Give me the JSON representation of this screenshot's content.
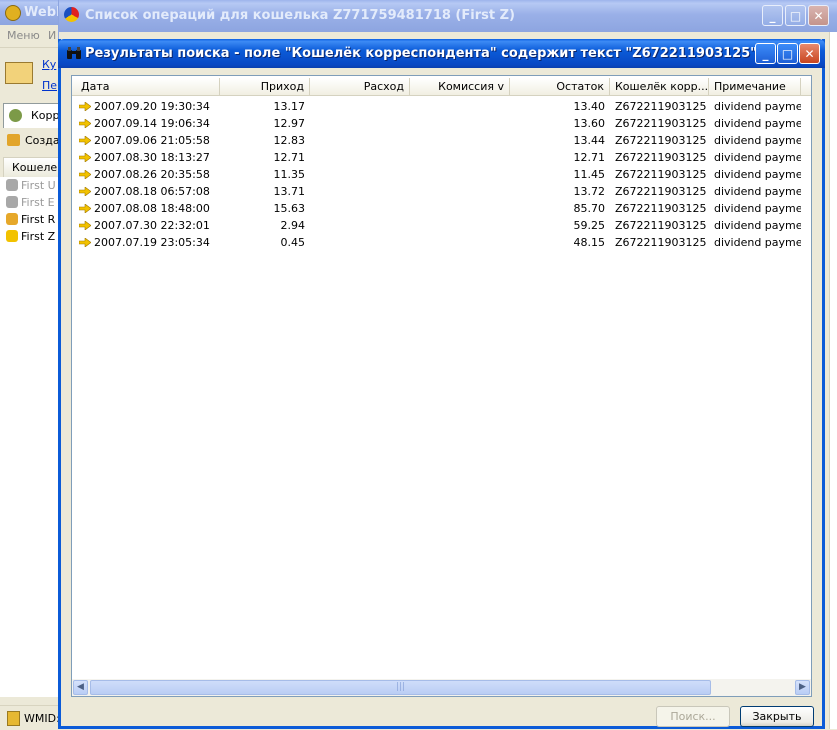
{
  "bg_app": {
    "title": "WebM",
    "menu": [
      "Меню",
      "И"
    ],
    "links": [
      "Ку",
      "Пер"
    ],
    "tab_label": "Корр",
    "create_label": "Созда",
    "wallets_header": "Кошелек",
    "wallets": [
      {
        "label": "First U",
        "dim": true
      },
      {
        "label": "First E",
        "dim": true
      },
      {
        "label": "First R",
        "dim": false
      },
      {
        "label": "First Z",
        "dim": false
      }
    ],
    "status": "WMID:"
  },
  "ops_window": {
    "title": "Список операций для кошелька Z771759481718 (First Z)"
  },
  "search_window": {
    "title": "Результаты поиска - поле \"Кошелёк корреспондента\" содержит текст \"Z672211903125\"",
    "columns": [
      "Дата",
      "Приход",
      "Расход",
      "Комиссия  v",
      "Остаток",
      "Кошелёк корр...",
      "Примечание"
    ],
    "rows": [
      {
        "date": "2007.09.20 19:30:34",
        "income": "13.17",
        "expense": "",
        "fee": "",
        "balance": "13.40",
        "wallet": "Z672211903125",
        "note": "dividend payment"
      },
      {
        "date": "2007.09.14 19:06:34",
        "income": "12.97",
        "expense": "",
        "fee": "",
        "balance": "13.60",
        "wallet": "Z672211903125",
        "note": "dividend payment"
      },
      {
        "date": "2007.09.06 21:05:58",
        "income": "12.83",
        "expense": "",
        "fee": "",
        "balance": "13.44",
        "wallet": "Z672211903125",
        "note": "dividend payment"
      },
      {
        "date": "2007.08.30 18:13:27",
        "income": "12.71",
        "expense": "",
        "fee": "",
        "balance": "12.71",
        "wallet": "Z672211903125",
        "note": "dividend payment"
      },
      {
        "date": "2007.08.26 20:35:58",
        "income": "11.35",
        "expense": "",
        "fee": "",
        "balance": "11.45",
        "wallet": "Z672211903125",
        "note": "dividend payment"
      },
      {
        "date": "2007.08.18 06:57:08",
        "income": "13.71",
        "expense": "",
        "fee": "",
        "balance": "13.72",
        "wallet": "Z672211903125",
        "note": "dividend payment"
      },
      {
        "date": "2007.08.08 18:48:00",
        "income": "15.63",
        "expense": "",
        "fee": "",
        "balance": "85.70",
        "wallet": "Z672211903125",
        "note": "dividend payment"
      },
      {
        "date": "2007.07.30 22:32:01",
        "income": "2.94",
        "expense": "",
        "fee": "",
        "balance": "59.25",
        "wallet": "Z672211903125",
        "note": "dividend payment"
      },
      {
        "date": "2007.07.19 23:05:34",
        "income": "0.45",
        "expense": "",
        "fee": "",
        "balance": "48.15",
        "wallet": "Z672211903125",
        "note": "dividend payment"
      }
    ],
    "search_button": "Поиск...",
    "close_button": "Закрыть"
  },
  "colors": {
    "xp_blue": "#0B5BD8",
    "close_red": "#C8451F",
    "arrow_yellow": "#F2C200"
  }
}
